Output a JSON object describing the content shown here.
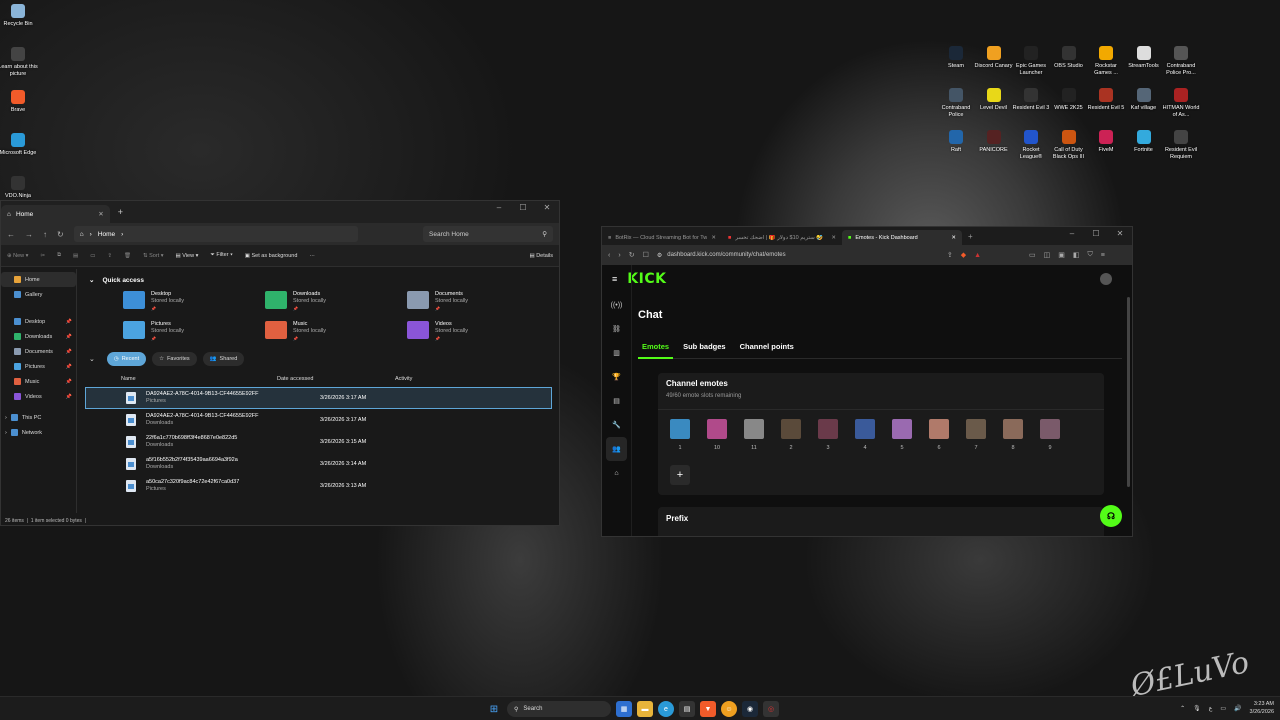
{
  "desktop": {
    "left_icons": [
      {
        "label": "Recycle Bin",
        "icon": "recycle-bin-icon",
        "color": "#8ab4d8"
      },
      {
        "label": "Learn about this picture",
        "icon": "info-icon",
        "color": "#444444"
      },
      {
        "label": "Brave",
        "icon": "brave-icon",
        "color": "#f25b2a"
      },
      {
        "label": "Microsoft Edge",
        "icon": "edge-icon",
        "color": "#2a9ad8"
      },
      {
        "label": "VDO.Ninja",
        "icon": "vdo-ninja-icon",
        "color": "#333333"
      }
    ],
    "right_icons": [
      {
        "label": "Steam",
        "icon": "steam-icon",
        "color": "#1b2838"
      },
      {
        "label": "Discord Canary",
        "icon": "discord-icon",
        "color": "#f0a020"
      },
      {
        "label": "Epic Games Launcher",
        "icon": "epic-games-icon",
        "color": "#222222"
      },
      {
        "label": "OBS Studio",
        "icon": "obs-icon",
        "color": "#333333"
      },
      {
        "label": "Rockstar Games ...",
        "icon": "rockstar-icon",
        "color": "#f2a900"
      },
      {
        "label": "StreamTools",
        "icon": "streamtools-icon",
        "color": "#dddddd"
      },
      {
        "label": "Contraband Police Pro...",
        "icon": "contraband-icon",
        "color": "#555555"
      },
      {
        "label": "Contraband Police",
        "icon": "contraband-police-icon",
        "color": "#445566"
      },
      {
        "label": "Level Devil",
        "icon": "level-devil-icon",
        "color": "#e8d818"
      },
      {
        "label": "Resident Evil 3",
        "icon": "re3-icon",
        "color": "#333333"
      },
      {
        "label": "WWE 2K25",
        "icon": "wwe-icon",
        "color": "#222222"
      },
      {
        "label": "Resident Evil 5",
        "icon": "re5-icon",
        "color": "#aa3322"
      },
      {
        "label": "Kaf village",
        "icon": "kaf-village-icon",
        "color": "#556677"
      },
      {
        "label": "HITMAN World of As...",
        "icon": "hitman-icon",
        "color": "#aa2222"
      },
      {
        "label": "Raft",
        "icon": "raft-icon",
        "color": "#2266aa"
      },
      {
        "label": "PANICORE",
        "icon": "panicore-icon",
        "color": "#552222"
      },
      {
        "label": "Rocket League®",
        "icon": "rocket-league-icon",
        "color": "#2255cc"
      },
      {
        "label": "Call of Duty Black Ops III",
        "icon": "cod-icon",
        "color": "#cc5511"
      },
      {
        "label": "FiveM",
        "icon": "fivem-icon",
        "color": "#cc2255"
      },
      {
        "label": "Fortnite",
        "icon": "fortnite-icon",
        "color": "#33aadd"
      },
      {
        "label": "Resident Evil Requiem",
        "icon": "re-requiem-icon",
        "color": "#444444"
      }
    ]
  },
  "explorer": {
    "tab_title": "Home",
    "address": "Home",
    "search_placeholder": "Search Home",
    "toolbar": {
      "new": "New",
      "sort": "Sort",
      "view": "View",
      "filter": "Filter",
      "set_background": "Set as background",
      "more": "···",
      "details": "Details"
    },
    "sidebar": [
      {
        "label": "Home",
        "color": "#e8a33a",
        "pinned": false
      },
      {
        "label": "Gallery",
        "color": "#4b8fd0",
        "pinned": false
      },
      {
        "label": "Desktop",
        "color": "#4b8fd0",
        "pinned": true
      },
      {
        "label": "Downloads",
        "color": "#2fb36b",
        "pinned": true
      },
      {
        "label": "Documents",
        "color": "#8a9ab0",
        "pinned": true
      },
      {
        "label": "Pictures",
        "color": "#4ba3e0",
        "pinned": true
      },
      {
        "label": "Music",
        "color": "#e06040",
        "pinned": true
      },
      {
        "label": "Videos",
        "color": "#8a55d8",
        "pinned": true
      }
    ],
    "sidebar_lower": [
      {
        "label": "This PC",
        "color": "#4b8fd0"
      },
      {
        "label": "Network",
        "color": "#4b8fd0"
      }
    ],
    "quick_access_title": "Quick access",
    "quick_access": [
      {
        "name": "Desktop",
        "sub": "Stored locally",
        "color": "#3d8fd8"
      },
      {
        "name": "Downloads",
        "sub": "Stored locally",
        "color": "#2fb36b"
      },
      {
        "name": "Documents",
        "sub": "Stored locally",
        "color": "#8a9ab0"
      },
      {
        "name": "Pictures",
        "sub": "Stored locally",
        "color": "#4ba3e0"
      },
      {
        "name": "Music",
        "sub": "Stored locally",
        "color": "#e06040"
      },
      {
        "name": "Videos",
        "sub": "Stored locally",
        "color": "#8a55d8"
      }
    ],
    "filters": {
      "recent": "Recent",
      "favorites": "Favorites",
      "shared": "Shared"
    },
    "columns": {
      "name": "Name",
      "date": "Date accessed",
      "activity": "Activity"
    },
    "files": [
      {
        "name": "DA924AE2-A78C-4014-9B13-CF44655E92FF",
        "location": "Pictures",
        "date": "3/26/2026 3:17 AM"
      },
      {
        "name": "DA924AE2-A78C-4014-9B13-CF44655E92FF",
        "location": "Downloads",
        "date": "3/26/2026 3:17 AM"
      },
      {
        "name": "22f6a1c770b698ff3f4e8687e0e822d5",
        "location": "Downloads",
        "date": "3/26/2026 3:15 AM"
      },
      {
        "name": "a5f16b552b2f74f35439aa6694a3f92a",
        "location": "Downloads",
        "date": "3/26/2026 3:14 AM"
      },
      {
        "name": "a50ca27c320f9ac84c72e42f67ca0d37",
        "location": "Pictures",
        "date": "3/26/2026 3:13 AM"
      }
    ],
    "status": {
      "items": "26 items",
      "selected": "1 item selected  0 bytes"
    }
  },
  "browser": {
    "tabs": [
      {
        "title": "BotRix — Cloud Streaming Bot for Tw",
        "active": false
      },
      {
        "title": "ستريم 10$ دولار 🎁 | اضحك تخسر 🤣",
        "active": false
      },
      {
        "title": "Emotes - Kick Dashboard",
        "active": true
      }
    ],
    "url": "dashboard.kick.com/community/chat/emotes",
    "logo": "KICK",
    "page_title": "Chat",
    "subtabs": [
      "Emotes",
      "Sub badges",
      "Channel points"
    ],
    "card_title": "Channel emotes",
    "card_sub": "49/60 emote slots remaining",
    "emotes": [
      {
        "label": "1",
        "color": "#3a8ac0"
      },
      {
        "label": "10",
        "color": "#b04a8a"
      },
      {
        "label": "11",
        "color": "#888888"
      },
      {
        "label": "2",
        "color": "#5a4a3a"
      },
      {
        "label": "3",
        "color": "#6a3a4a"
      },
      {
        "label": "4",
        "color": "#3a5a9a"
      },
      {
        "label": "5",
        "color": "#9a6ab0"
      },
      {
        "label": "6",
        "color": "#b07a6a"
      },
      {
        "label": "7",
        "color": "#6a5a4a"
      },
      {
        "label": "8",
        "color": "#8a6a5a"
      },
      {
        "label": "9",
        "color": "#7a5a6a"
      }
    ],
    "add_label": "+",
    "prefix_title": "Prefix"
  },
  "taskbar": {
    "search": "Search",
    "time": "3:23 AM",
    "date": "3/26/2026",
    "lang": "ع"
  },
  "signature": "Ø£LuVo"
}
